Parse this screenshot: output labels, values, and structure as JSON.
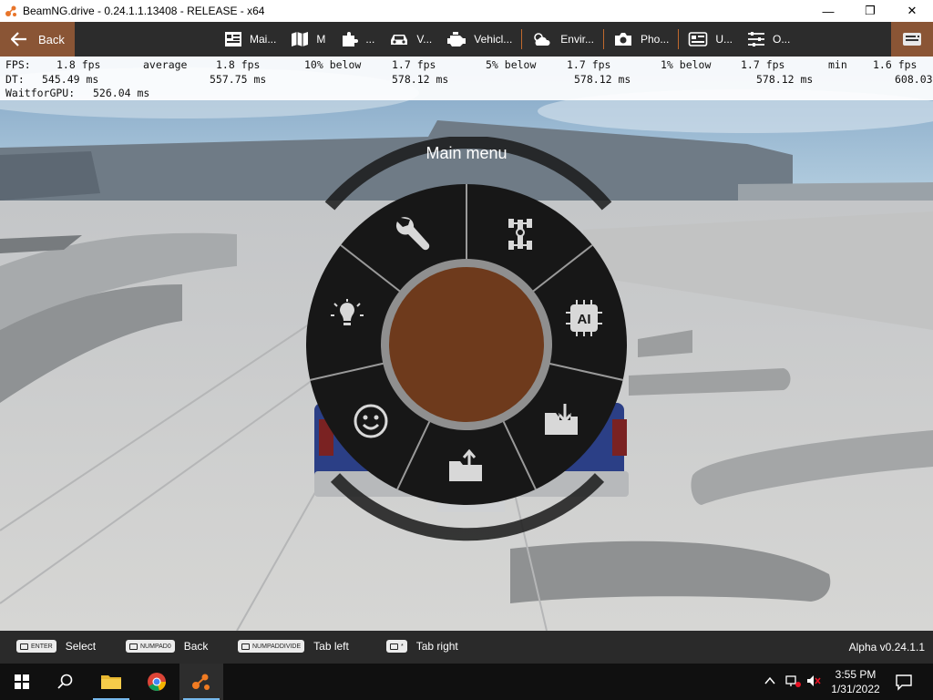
{
  "window": {
    "title": "BeamNG.drive - 0.24.1.1.13408 - RELEASE - x64",
    "minimize_glyph": "—",
    "maximize_glyph": "❐",
    "close_glyph": "✕"
  },
  "toolbar": {
    "back_label": "Back",
    "items": [
      {
        "label": "Mai...",
        "icon": "main-menu-icon"
      },
      {
        "label": "M",
        "icon": "map-icon"
      },
      {
        "label": "...",
        "icon": "puzzle-icon"
      },
      {
        "label": "V...",
        "icon": "car-icon"
      },
      {
        "label": "Vehicl...",
        "icon": "engine-icon"
      },
      {
        "label": "Envir...",
        "icon": "weather-icon"
      },
      {
        "label": "Pho...",
        "icon": "camera-icon"
      },
      {
        "label": "U...",
        "icon": "ui-apps-icon"
      },
      {
        "label": "O...",
        "icon": "sliders-icon"
      }
    ]
  },
  "fps_overlay": {
    "row1": {
      "fps_label": "FPS:",
      "fps_value": "1.8 fps",
      "avg_label": "average",
      "avg_value": "1.8 fps",
      "p10_label": "10% below",
      "p10_value": "1.7 fps",
      "p5_label": "5% below",
      "p5_value": "1.7 fps",
      "p1_label": "1% below",
      "p1_value": "1.7 fps",
      "min_label": "min",
      "min_value": "1.6 fps"
    },
    "row2": {
      "dt_label": "DT:",
      "dt_value": "545.49 ms",
      "avg_value": "557.75 ms",
      "p10_value": "578.12 ms",
      "p5_value": "578.12 ms",
      "p1_value": "578.12 ms",
      "min_value": "608.03"
    },
    "row3": {
      "label": "WaitforGPU:",
      "value": "526.04 ms"
    }
  },
  "radial_menu": {
    "title": "Main menu",
    "center_color": "#6e3a1c",
    "segments": [
      {
        "icon": "wrench-icon"
      },
      {
        "icon": "chassis-icon"
      },
      {
        "icon": "ai-chip-icon"
      },
      {
        "icon": "folder-load-icon"
      },
      {
        "icon": "folder-save-icon"
      },
      {
        "icon": "smiley-icon"
      },
      {
        "icon": "lightbulb-icon"
      }
    ]
  },
  "hints": [
    {
      "key": "ENTER",
      "label": "Select"
    },
    {
      "key": "NUMPAD0",
      "label": "Back"
    },
    {
      "key": "NUMPADDIVIDE",
      "label": "Tab left"
    },
    {
      "key": "*",
      "label": "Tab right"
    }
  ],
  "version": "Alpha v0.24.1.1",
  "taskbar": {
    "time": "3:55 PM",
    "date": "1/31/2022"
  },
  "colors": {
    "accent": "#c0692d",
    "back_button": "#8a5535",
    "toolbar_bg": "#2c2c2c",
    "menu_bg": "#181818"
  }
}
